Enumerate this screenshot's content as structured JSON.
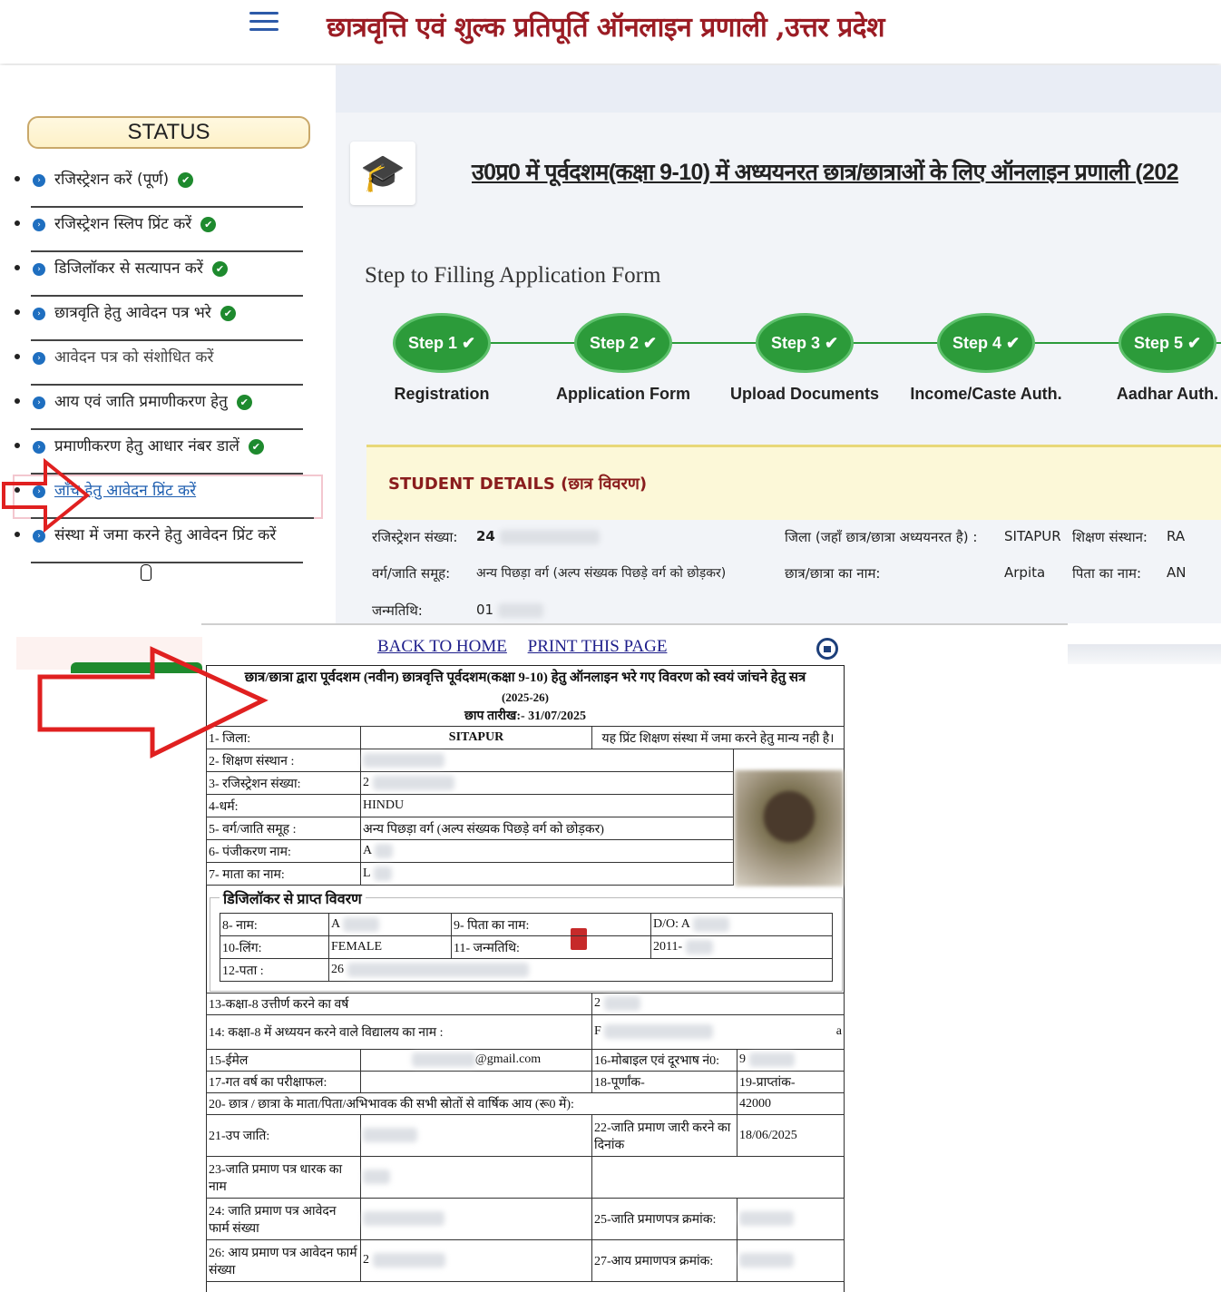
{
  "header": {
    "title": "छात्रवृत्ति एवं शुल्क प्रतिपूर्ति ऑनलाइन प्रणाली ,उत्तर प्रदेश",
    "menu_icon": "hamburger-icon"
  },
  "sidebar": {
    "status_label": "STATUS",
    "items": [
      {
        "label": "रजिस्ट्रेशन करें (पूर्ण)",
        "done": "✔"
      },
      {
        "label": "रजिस्ट्रेशन स्लिप प्रिंट करें",
        "done": "✔"
      },
      {
        "label": "डिजिलॉकर से सत्यापन करें",
        "done": "✔"
      },
      {
        "label": "छात्रवृति हेतु आवेदन पत्र भरे",
        "done": "✔"
      },
      {
        "label": "आवेदन पत्र को संशोधित करें",
        "done": ""
      },
      {
        "label": "आय एवं जाति प्रमाणीकरण हेतु",
        "done": "✔"
      },
      {
        "label": "प्रमाणीकरण हेतु आधार नंबर डालें",
        "done": "✔"
      },
      {
        "label": "जाँच हेतु आवेदन प्रिंट करें",
        "done": ""
      },
      {
        "label": "संस्था में जमा करने हेतु आवेदन प्रिंट करें",
        "done": ""
      }
    ]
  },
  "main": {
    "heading": "उ0प्र0 में पूर्वदशम(कक्षा 9-10) में अध्ययनरत छात्र/छात्राओं के लिए ऑनलाइन प्रणाली (202",
    "step_title": "Step to Filling Application Form",
    "steps": [
      {
        "badge": "Step 1",
        "label": "Registration"
      },
      {
        "badge": "Step 2",
        "label": "Application Form"
      },
      {
        "badge": "Step 3",
        "label": "Upload Documents"
      },
      {
        "badge": "Step 4",
        "label": "Income/Caste Auth."
      },
      {
        "badge": "Step 5",
        "label": "Aadhar Auth."
      }
    ],
    "student_details": {
      "title": "STUDENT DETAILS (छात्र विवरण)",
      "reg_label": "रजिस्ट्रेशन संख्या:",
      "reg_value": "24",
      "district_label": "जिला (जहाँ छात्र/छात्रा अध्ययनरत है) :",
      "district_value": "SITAPUR",
      "institute_label": "शिक्षण संस्थान:",
      "institute_value": "RA",
      "category_label": "वर्ग/जाति समूह:",
      "category_value": "अन्य पिछड़ा वर्ग (अल्प संख्यक पिछड़े वर्ग को छोड़कर)",
      "name_label": "छात्र/छात्रा का नाम:",
      "name_value": "Arpita",
      "father_label": "पिता का नाम:",
      "father_value": "AN",
      "dob_label": "जन्मतिथि:",
      "dob_value": "01"
    }
  },
  "print": {
    "back_link": "BACK TO HOME",
    "print_link": "PRINT THIS PAGE",
    "doc_title_1": "छात्र/छात्रा द्वारा पूर्वदशम (नवीन) छात्रवृत्ति पूर्वदशम(कक्षा 9-10) हेतु ऑनलाइन भरे गए विवरण को स्वयं जांचने हेतु सत्र",
    "doc_title_2": "(2025-26)",
    "doc_title_3": "छाप तारीख:- 31/07/2025",
    "f1_label": "1- जिला:",
    "f1_value": "SITAPUR",
    "f1_note": "यह प्रिंट शिक्षण संस्था में जमा करने हेतु मान्य नही है।",
    "f2_label": "2- शिक्षण संस्थान :",
    "f3_label": "3- रजिस्ट्रेशन संख्या:",
    "f3_value": "2",
    "f4_label": "4-धर्म:",
    "f4_value": "HINDU",
    "f5_label": "5- वर्ग/जाति समूह :",
    "f5_value": "अन्य पिछड़ा वर्ग (अल्प संख्यक पिछड़े वर्ग को छोड़कर)",
    "f6_label": "6- पंजीकरण नाम:",
    "f6_value": "A",
    "f7_label": "7- माता का नाम:",
    "f7_value": "L",
    "digilocker_title": "डिजिलॉकर से प्राप्त विवरण",
    "f8_label": "8- नाम:",
    "f8_value": "A",
    "f9_label": "9- पिता का नाम:",
    "f9_value": "D/O: A",
    "f10_label": "10-लिंग:",
    "f10_value": "FEMALE",
    "f11_label": "11- जन्मतिथि:",
    "f11_value": "2011-",
    "f12_label": "12-पता :",
    "f12_value": "26",
    "f13_label": "13-कक्षा-8 उत्तीर्ण करने का वर्ष",
    "f13_value": "2",
    "f14_label": "14: कक्षा-8 में अध्ययन करने वाले विद्यालय का नाम :",
    "f14_value": "F",
    "f14_tail": "a",
    "f15_label": "15-ईमेल",
    "f15_value": "@gmail.com",
    "f16_label": "16-मोबाइल एवं दूरभाष नं0:",
    "f16_value": "9",
    "f17_label": "17-गत वर्ष का परीक्षाफल:",
    "f18_label": "18-पूर्णांक-",
    "f19_label": "19-प्राप्तांक-",
    "f20_label": "20- छात्र / छात्रा के माता/पिता/अभिभावक की सभी स्रोतों से वार्षिक आय (रू0 में):",
    "f20_value": "42000",
    "f21_label": "21-उप जाति:",
    "f22_label": "22-जाति प्रमाण जारी करने का दिनांक",
    "f22_value": "18/06/2025",
    "f23_label": "23-जाति प्रमाण पत्र धारक का नाम",
    "f24_label": "24: जाति प्रमाण पत्र आवेदन फार्म संख्या",
    "f25_label": "25-जाति प्रमाणपत्र क्रमांक:",
    "f26_label": "26: आय प्रमाण पत्र आवेदन फार्म संख्या",
    "f26_value": "2",
    "f27_label": "27-आय प्रमाणपत्र क्रमांक:"
  },
  "colors": {
    "title_red": "#9b1c24",
    "step_green": "#2c9b3a",
    "arrow_red": "#e02020",
    "link_blue": "#1d1d8a"
  }
}
